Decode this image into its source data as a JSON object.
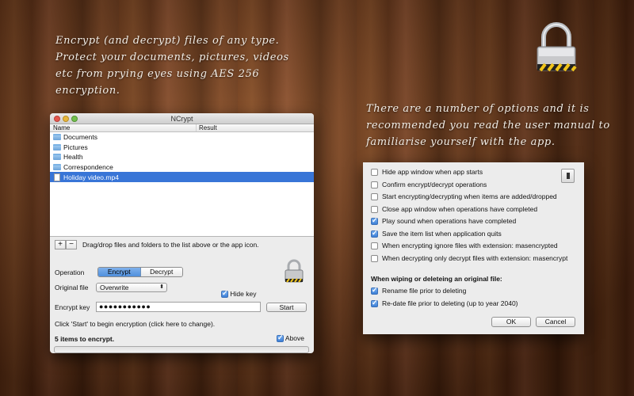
{
  "captions": {
    "left": "Encrypt (and decrypt) files of any type. Protect your documents, pictures, videos etc from prying eyes using AES 256 encryption.",
    "right": "There are a number of options and it is recommended you read the user manual to familiarise yourself with the app."
  },
  "window": {
    "title": "NCrypt",
    "columns": {
      "name": "Name",
      "result": "Result"
    },
    "files": [
      {
        "name": "Documents",
        "icon": "folder-icon",
        "selected": false
      },
      {
        "name": "Pictures",
        "icon": "folder-icon",
        "selected": false
      },
      {
        "name": "Health",
        "icon": "folder-icon",
        "selected": false
      },
      {
        "name": "Correspondence",
        "icon": "folder-icon",
        "selected": false
      },
      {
        "name": "Holiday video.mp4",
        "icon": "document-icon",
        "selected": true
      }
    ],
    "add_label": "+",
    "remove_label": "−",
    "drag_hint": "Drag/drop files and folders to the list above or the app icon.",
    "operation_label": "Operation",
    "encrypt_label": "Encrypt",
    "decrypt_label": "Decrypt",
    "original_file_label": "Original file",
    "original_file_value": "Overwrite",
    "hide_key_label": "Hide key",
    "encrypt_key_label": "Encrypt key",
    "encrypt_key_value": "●●●●●●●●●●●",
    "start_label": "Start",
    "hint": "Click 'Start' to begin encryption (click here to change).",
    "count_text": "5 items to encrypt.",
    "above_label": "Above"
  },
  "options": {
    "items": [
      {
        "label": "Hide app window when app starts",
        "checked": false
      },
      {
        "label": "Confirm encrypt/decrypt operations",
        "checked": false
      },
      {
        "label": "Start encrypting/decrypting when items are added/dropped",
        "checked": false
      },
      {
        "label": "Close app window when operations have completed",
        "checked": false
      },
      {
        "label": "Play sound when operations have completed",
        "checked": true
      },
      {
        "label": "Save the item list when application quits",
        "checked": true
      },
      {
        "label": "When encrypting ignore files with extension:  masencrypted",
        "checked": false
      },
      {
        "label": "When decrypting only decrypt files with extension:  masencrypt",
        "checked": false
      }
    ],
    "wipe_title": "When wiping or deleteing an original file:",
    "wipe_items": [
      {
        "label": "Rename file prior to deleting",
        "checked": true
      },
      {
        "label": "Re-date file prior to deleting (up to year 2040)",
        "checked": true
      }
    ],
    "ok_label": "OK",
    "cancel_label": "Cancel"
  },
  "colors": {
    "selection": "#3875d7",
    "segment_active": "#4f8fdd"
  }
}
